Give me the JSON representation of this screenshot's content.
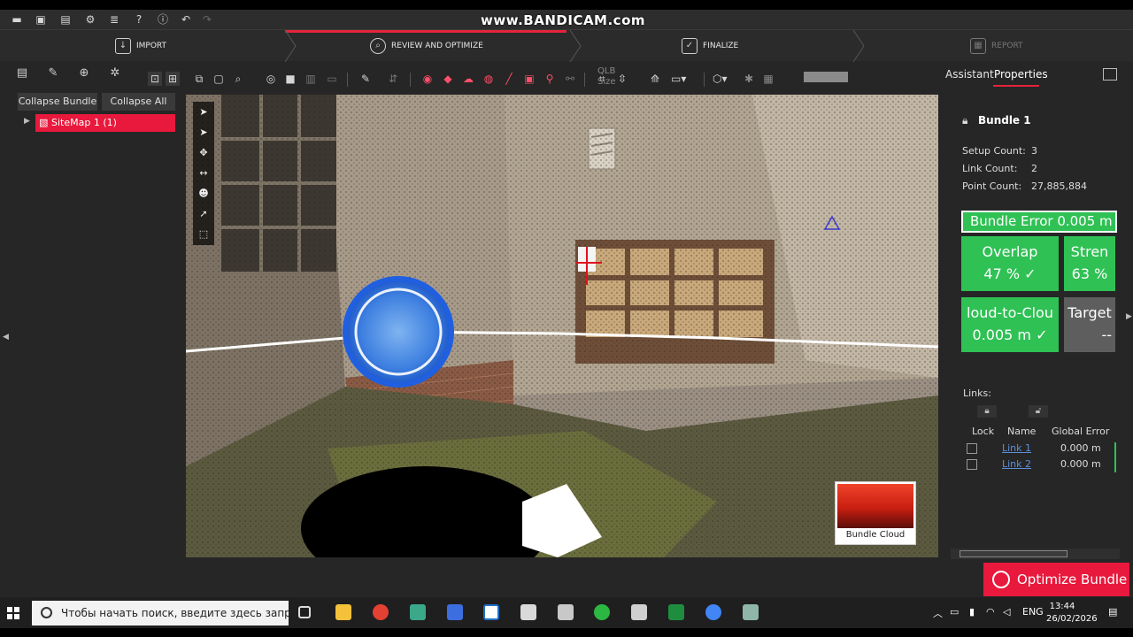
{
  "recording_watermark": "www.BANDICAM.com",
  "workflow": {
    "steps": [
      {
        "label": "IMPORT",
        "icon": "import-icon"
      },
      {
        "label": "REVIEW AND OPTIMIZE",
        "icon": "review-icon",
        "active": true
      },
      {
        "label": "FINALIZE",
        "icon": "finalize-icon"
      },
      {
        "label": "REPORT",
        "icon": "report-icon",
        "disabled": true
      }
    ]
  },
  "left_panel": {
    "collapse_bundle": "Collapse Bundle",
    "collapse_all": "Collapse All",
    "tree": [
      {
        "label": "SiteMap 1 (1)",
        "selected": true
      }
    ]
  },
  "toolbar": {
    "qlb_size_label": "QLB Size"
  },
  "viewport": {
    "thumbnail_caption": "Bundle Cloud"
  },
  "right_panel": {
    "tabs": [
      "Assistant",
      "Properties"
    ],
    "active_tab": "Properties",
    "bundle_title": "Bundle 1",
    "stats": [
      {
        "label": "Setup Count:",
        "value": "3"
      },
      {
        "label": "Link Count:",
        "value": "2"
      },
      {
        "label": "Point Count:",
        "value": "27,885,884"
      }
    ],
    "bundle_error": "Bundle Error 0.005 m",
    "tiles": [
      {
        "line1": "Overlap",
        "line2": "47 %  ✓",
        "color": "#2fc154"
      },
      {
        "line1": "Stren",
        "line2": "63 %",
        "color": "#2fc154"
      },
      {
        "line1": "loud-to-Clou",
        "line2": "0.005 m  ✓",
        "color": "#2fc154"
      },
      {
        "line1": "Target",
        "line2": "--",
        "color": "#5e5e5e"
      }
    ],
    "links_label": "Links:",
    "table_headers": [
      "Lock",
      "Name",
      "Global Error"
    ],
    "links": [
      {
        "name": "Link 1",
        "error": "0.000 m"
      },
      {
        "name": "Link 2",
        "error": "0.000 m"
      }
    ],
    "optimize_button": "Optimize Bundle"
  },
  "taskbar": {
    "search_placeholder": "Чтобы начать поиск, введите здесь запрос",
    "language": "ENG",
    "time": "13:44",
    "date": "26/02/2026"
  },
  "colors": {
    "accent_red": "#e8193c",
    "status_green": "#2fc154"
  }
}
